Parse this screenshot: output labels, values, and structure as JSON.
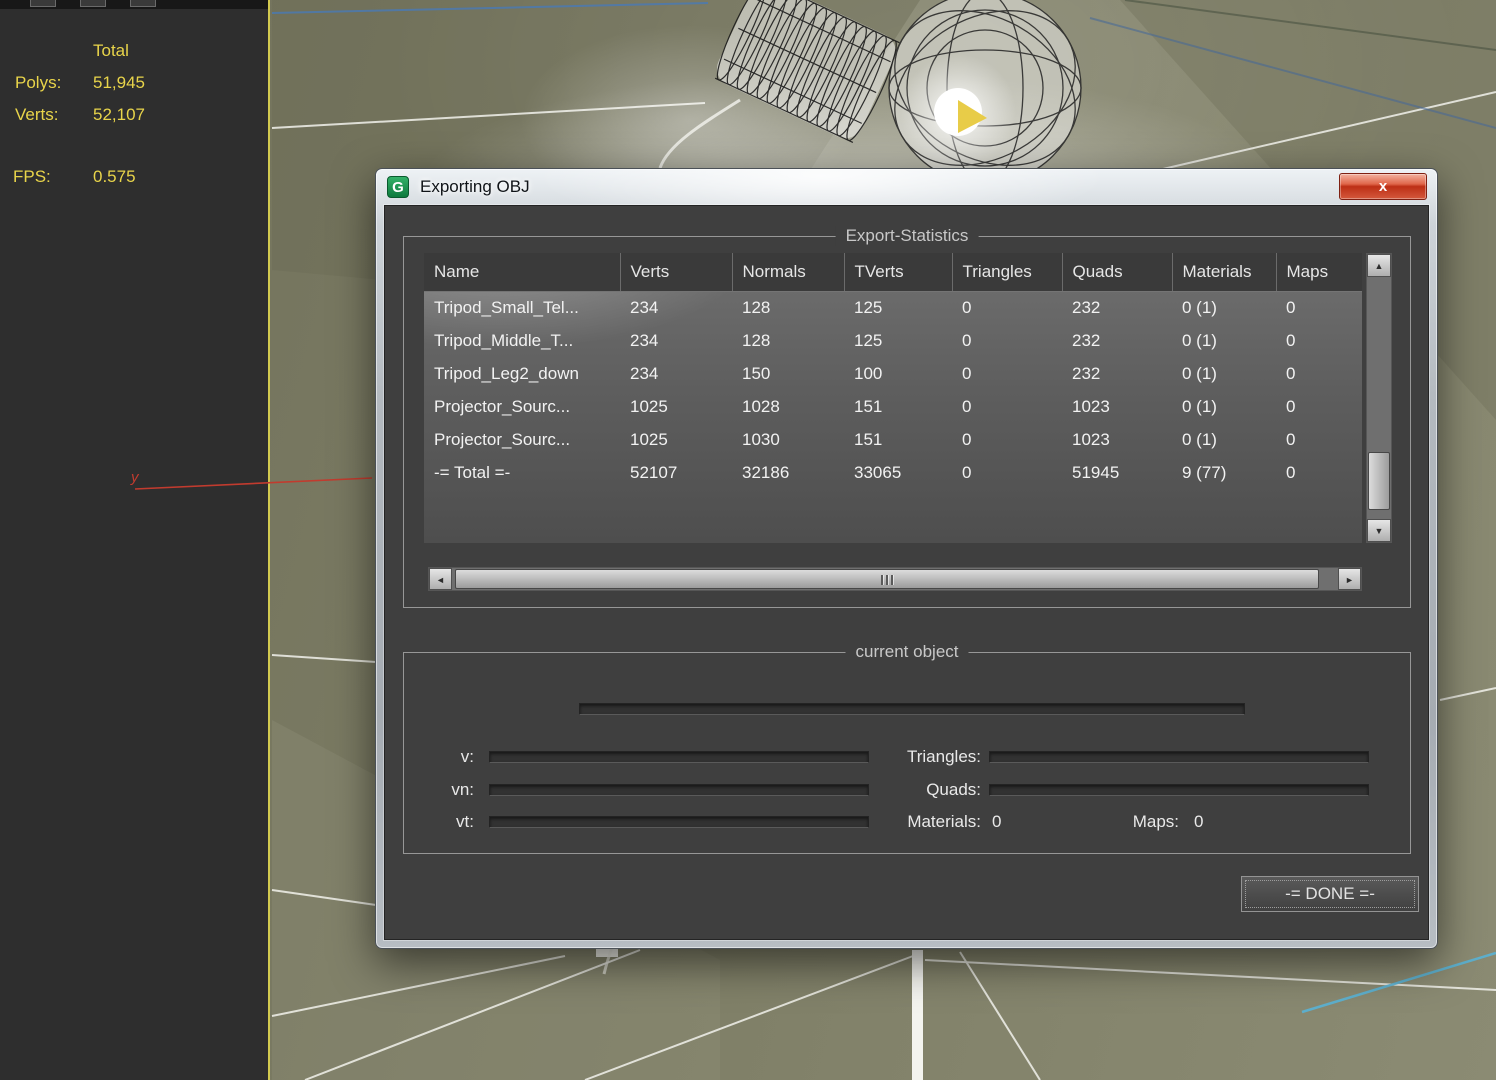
{
  "colors": {
    "viewport_olive": "#7c7c64",
    "stats_yellow": "#e8d44a",
    "axis_red": "#c23b2e",
    "border_yellow": "#d8cf4e",
    "dialog_dark": "#3f3f3f"
  },
  "icons": {
    "app": "G",
    "close": "x",
    "scroll_up": "▲",
    "scroll_down": "▼",
    "scroll_left": "◄",
    "scroll_right": "►"
  },
  "viewport": {
    "axis_label": "y",
    "stats": {
      "total_label": "Total",
      "polys_label": "Polys:",
      "polys_value": "51,945",
      "verts_label": "Verts:",
      "verts_value": "52,107",
      "fps_label": "FPS:",
      "fps_value": "0.575"
    }
  },
  "dialog": {
    "title": "Exporting OBJ",
    "stats_group_title": "Export-Statistics",
    "table": {
      "columns": [
        "Name",
        "Verts",
        "Normals",
        "TVerts",
        "Triangles",
        "Quads",
        "Materials",
        "Maps"
      ],
      "rows": [
        [
          "Tripod_Small_Tel...",
          "234",
          "128",
          "125",
          "0",
          "232",
          "0 (1)",
          "0"
        ],
        [
          "Tripod_Middle_T...",
          "234",
          "128",
          "125",
          "0",
          "232",
          "0 (1)",
          "0"
        ],
        [
          "Tripod_Leg2_down",
          "234",
          "150",
          "100",
          "0",
          "232",
          "0 (1)",
          "0"
        ],
        [
          "Projector_Sourc...",
          "1025",
          "1028",
          "151",
          "0",
          "1023",
          "0 (1)",
          "0"
        ],
        [
          "Projector_Sourc...",
          "1025",
          "1030",
          "151",
          "0",
          "1023",
          "0 (1)",
          "0"
        ],
        [
          "-= Total =-",
          "52107",
          "32186",
          "33065",
          "0",
          "51945",
          "9 (77)",
          "0"
        ]
      ]
    },
    "current_group_title": "current object",
    "progress": {
      "v_label": "v:",
      "vn_label": "vn:",
      "vt_label": "vt:",
      "triangles_label": "Triangles:",
      "quads_label": "Quads:",
      "materials_label": "Materials:",
      "materials_value": "0",
      "maps_label": "Maps:",
      "maps_value": "0"
    },
    "done_button": "-= DONE =-"
  }
}
